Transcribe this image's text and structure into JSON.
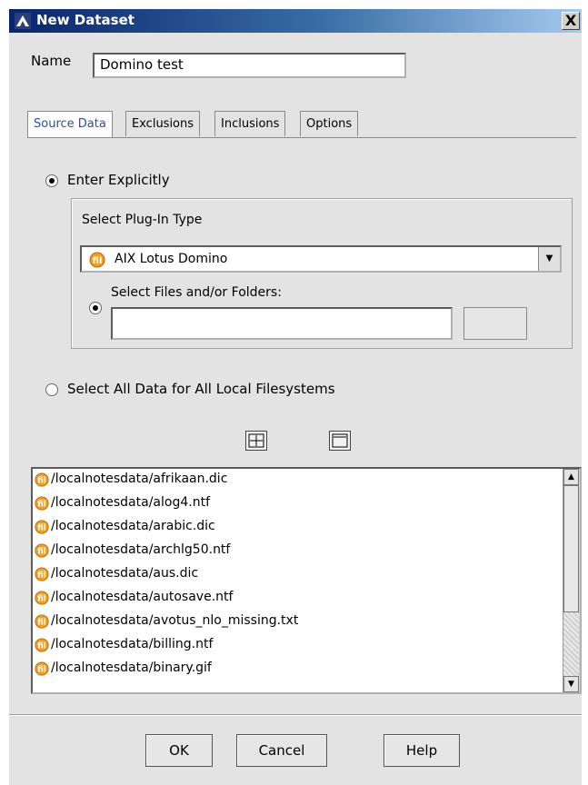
{
  "window": {
    "title": "New Dataset",
    "close_label": "X"
  },
  "name_field": {
    "label": "Name",
    "value": "Domino test"
  },
  "tabs": [
    {
      "label": "Source Data",
      "active": true
    },
    {
      "label": "Exclusions",
      "active": false
    },
    {
      "label": "Inclusions",
      "active": false
    },
    {
      "label": "Options",
      "active": false
    }
  ],
  "source": {
    "enter_explicitly_label": "Enter Explicitly",
    "plugin_type_label": "Select Plug-In Type",
    "plugin_type_value": "AIX Lotus Domino",
    "select_files_label": "Select Files and/or Folders:",
    "select_all_label": "Select All Data for All Local Filesystems"
  },
  "file_list": [
    "/localnotesdata/afrikaan.dic",
    "/localnotesdata/alog4.ntf",
    "/localnotesdata/arabic.dic",
    "/localnotesdata/archlg50.ntf",
    "/localnotesdata/aus.dic",
    "/localnotesdata/autosave.ntf",
    "/localnotesdata/avotus_nlo_missing.txt",
    "/localnotesdata/billing.ntf",
    "/localnotesdata/binary.gif"
  ],
  "buttons": {
    "ok": "OK",
    "cancel": "Cancel",
    "help": "Help"
  },
  "colors": {
    "title_bar": "#0a246a",
    "active_tab_text": "#2a4fa0",
    "file_icon": "#f0a020"
  }
}
